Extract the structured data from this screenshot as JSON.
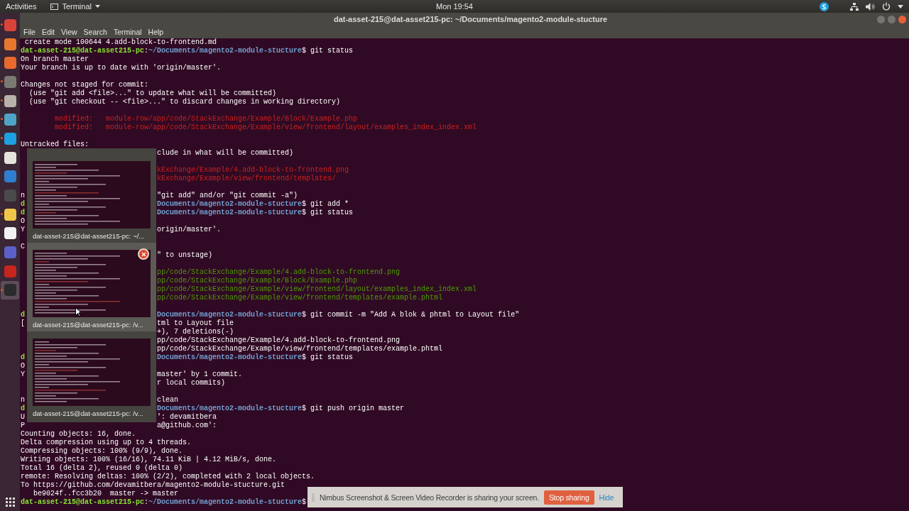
{
  "top_bar": {
    "activities": "Activities",
    "app_menu": "Terminal",
    "clock": "Mon 19:54"
  },
  "dock": {
    "items": [
      {
        "color": "#d9443a",
        "running": true,
        "selected": false
      },
      {
        "color": "#e8772e",
        "running": false,
        "selected": false
      },
      {
        "color": "#e9692c",
        "running": false,
        "selected": false
      },
      {
        "color": "#7a7a72",
        "running": true,
        "selected": false
      },
      {
        "color": "#b8b3aa",
        "running": true,
        "selected": false
      },
      {
        "color": "#4fa3c9",
        "running": true,
        "selected": false
      },
      {
        "color": "#1ea1e0",
        "running": true,
        "selected": false
      },
      {
        "color": "#e6e3dd",
        "running": false,
        "selected": false
      },
      {
        "color": "#2f7ed0",
        "running": false,
        "selected": false
      },
      {
        "color": "#4a4a4a",
        "running": false,
        "selected": false
      },
      {
        "color": "#efc64a",
        "running": true,
        "selected": false
      },
      {
        "color": "#f2f2f2",
        "running": false,
        "selected": false
      },
      {
        "color": "#5b5fc7",
        "running": false,
        "selected": false
      },
      {
        "color": "#c7251e",
        "running": false,
        "selected": false
      },
      {
        "color": "#2b2b2b",
        "running": true,
        "selected": true
      }
    ]
  },
  "window": {
    "title": "dat-asset-215@dat-asset215-pc: ~/Documents/magento2-module-stucture",
    "menu": [
      "File",
      "Edit",
      "View",
      "Search",
      "Terminal",
      "Help"
    ]
  },
  "terminal": {
    "lines": [
      {
        "kind": "full",
        "segments": [
          {
            "kind": "plain",
            "text": " create mode 100644 4.add-block-to-frontend.md"
          }
        ]
      },
      {
        "kind": "full",
        "segments": [
          {
            "kind": "user",
            "text": "dat-asset-215@dat-asset215-pc"
          },
          {
            "kind": "plain",
            "text": ":"
          },
          {
            "kind": "path",
            "text": "~/Documents/magento2-module-stucture"
          },
          {
            "kind": "plain",
            "text": "$ git status"
          }
        ]
      },
      {
        "kind": "full",
        "segments": [
          {
            "kind": "plain",
            "text": "On branch master"
          }
        ]
      },
      {
        "kind": "full",
        "segments": [
          {
            "kind": "plain",
            "text": "Your branch is up to date with 'origin/master'."
          }
        ]
      },
      {
        "kind": "blank"
      },
      {
        "kind": "full",
        "segments": [
          {
            "kind": "plain",
            "text": "Changes not staged for commit:"
          }
        ]
      },
      {
        "kind": "full",
        "segments": [
          {
            "kind": "plain",
            "text": "  (use \"git add <file>...\" to update what will be committed)"
          }
        ]
      },
      {
        "kind": "full",
        "segments": [
          {
            "kind": "plain",
            "text": "  (use \"git checkout -- <file>...\" to discard changes in working directory)"
          }
        ]
      },
      {
        "kind": "blank"
      },
      {
        "kind": "full",
        "segments": [
          {
            "kind": "unstaged",
            "text": "        modified:   module-row/app/code/StackExchange/Example/Block/Example.php"
          }
        ]
      },
      {
        "kind": "full",
        "segments": [
          {
            "kind": "unstaged",
            "text": "        modified:   module-row/app/code/StackExchange/Example/view/frontend/layout/examples_index_index.xml"
          }
        ]
      },
      {
        "kind": "blank"
      },
      {
        "kind": "full",
        "segments": [
          {
            "kind": "plain",
            "text": "Untracked files:"
          }
        ]
      },
      {
        "kind": "split",
        "right": [
          {
            "kind": "plain",
            "text": "clude in what will be committed)"
          }
        ]
      },
      {
        "kind": "blank"
      },
      {
        "kind": "split",
        "right": [
          {
            "kind": "unstaged",
            "text": "kExchange/Example/4.add-block-to-frontend.png"
          }
        ]
      },
      {
        "kind": "split",
        "right": [
          {
            "kind": "unstaged",
            "text": "kExchange/Example/view/frontend/templates/"
          }
        ]
      },
      {
        "kind": "blank"
      },
      {
        "kind": "split",
        "left": [
          {
            "kind": "plain",
            "text": "n"
          }
        ],
        "right": [
          {
            "kind": "plain",
            "text": "\"git add\" and/or \"git commit -a\")"
          }
        ]
      },
      {
        "kind": "split",
        "left": [
          {
            "kind": "user",
            "text": "d"
          }
        ],
        "right": [
          {
            "kind": "path",
            "text": "Documents/magento2-module-stucture"
          },
          {
            "kind": "plain",
            "text": "$ git add *"
          }
        ]
      },
      {
        "kind": "split",
        "left": [
          {
            "kind": "user",
            "text": "d"
          }
        ],
        "right": [
          {
            "kind": "path",
            "text": "Documents/magento2-module-stucture"
          },
          {
            "kind": "plain",
            "text": "$ git status"
          }
        ]
      },
      {
        "kind": "split",
        "left": [
          {
            "kind": "plain",
            "text": "O"
          }
        ]
      },
      {
        "kind": "split",
        "left": [
          {
            "kind": "plain",
            "text": "Y"
          }
        ],
        "right": [
          {
            "kind": "plain",
            "text": "origin/master'."
          }
        ]
      },
      {
        "kind": "blank"
      },
      {
        "kind": "split",
        "left": [
          {
            "kind": "plain",
            "text": "C"
          }
        ]
      },
      {
        "kind": "split",
        "right": [
          {
            "kind": "plain",
            "text": "\" to unstage)"
          }
        ]
      },
      {
        "kind": "blank"
      },
      {
        "kind": "split",
        "right": [
          {
            "kind": "staged",
            "text": "pp/code/StackExchange/Example/4.add-block-to-frontend.png"
          }
        ]
      },
      {
        "kind": "split",
        "right": [
          {
            "kind": "staged",
            "text": "pp/code/StackExchange/Example/Block/Example.php"
          }
        ]
      },
      {
        "kind": "split",
        "right": [
          {
            "kind": "staged",
            "text": "pp/code/StackExchange/Example/view/frontend/layout/examples_index_index.xml"
          }
        ]
      },
      {
        "kind": "split",
        "right": [
          {
            "kind": "staged",
            "text": "pp/code/StackExchange/Example/view/frontend/templates/example.phtml"
          }
        ]
      },
      {
        "kind": "blank"
      },
      {
        "kind": "split",
        "left": [
          {
            "kind": "user",
            "text": "d"
          }
        ],
        "right": [
          {
            "kind": "path",
            "text": "Documents/magento2-module-stucture"
          },
          {
            "kind": "plain",
            "text": "$ git commit -m \"Add A blok & phtml to Layout file\""
          }
        ]
      },
      {
        "kind": "split",
        "left": [
          {
            "kind": "plain",
            "text": "["
          }
        ],
        "right": [
          {
            "kind": "plain",
            "text": "tml to Layout file"
          }
        ]
      },
      {
        "kind": "split",
        "right": [
          {
            "kind": "plain",
            "text": "+), 7 deletions(-)"
          }
        ]
      },
      {
        "kind": "split",
        "right": [
          {
            "kind": "plain",
            "text": "pp/code/StackExchange/Example/4.add-block-to-frontend.png"
          }
        ]
      },
      {
        "kind": "split",
        "right": [
          {
            "kind": "plain",
            "text": "pp/code/StackExchange/Example/view/frontend/templates/example.phtml"
          }
        ]
      },
      {
        "kind": "split",
        "left": [
          {
            "kind": "user",
            "text": "d"
          }
        ],
        "right": [
          {
            "kind": "path",
            "text": "Documents/magento2-module-stucture"
          },
          {
            "kind": "plain",
            "text": "$ git status"
          }
        ]
      },
      {
        "kind": "split",
        "left": [
          {
            "kind": "plain",
            "text": "O"
          }
        ]
      },
      {
        "kind": "split",
        "left": [
          {
            "kind": "plain",
            "text": "Y"
          }
        ],
        "right": [
          {
            "kind": "plain",
            "text": "master' by 1 commit."
          }
        ]
      },
      {
        "kind": "split",
        "right": [
          {
            "kind": "plain",
            "text": "r local commits)"
          }
        ]
      },
      {
        "kind": "blank"
      },
      {
        "kind": "split",
        "left": [
          {
            "kind": "plain",
            "text": "n"
          }
        ],
        "right": [
          {
            "kind": "plain",
            "text": "clean"
          }
        ]
      },
      {
        "kind": "split",
        "left": [
          {
            "kind": "user",
            "text": "d"
          }
        ],
        "right": [
          {
            "kind": "path",
            "text": "Documents/magento2-module-stucture"
          },
          {
            "kind": "plain",
            "text": "$ git push origin master"
          }
        ]
      },
      {
        "kind": "split",
        "left": [
          {
            "kind": "plain",
            "text": "U"
          }
        ],
        "right": [
          {
            "kind": "plain",
            "text": "': devamitbera"
          }
        ]
      },
      {
        "kind": "split",
        "left": [
          {
            "kind": "plain",
            "text": "P"
          }
        ],
        "right": [
          {
            "kind": "plain",
            "text": "a@github.com':"
          }
        ]
      },
      {
        "kind": "full",
        "segments": [
          {
            "kind": "plain",
            "text": "Counting objects: 16, done."
          }
        ]
      },
      {
        "kind": "full",
        "segments": [
          {
            "kind": "plain",
            "text": "Delta compression using up to 4 threads."
          }
        ]
      },
      {
        "kind": "full",
        "segments": [
          {
            "kind": "plain",
            "text": "Compressing objects: 100% (9/9), done."
          }
        ]
      },
      {
        "kind": "full",
        "segments": [
          {
            "kind": "plain",
            "text": "Writing objects: 100% (16/16), 74.11 KiB | 4.12 MiB/s, done."
          }
        ]
      },
      {
        "kind": "full",
        "segments": [
          {
            "kind": "plain",
            "text": "Total 16 (delta 2), reused 0 (delta 0)"
          }
        ]
      },
      {
        "kind": "full",
        "segments": [
          {
            "kind": "plain",
            "text": "remote: Resolving deltas: 100% (2/2), completed with 2 local objects."
          }
        ]
      },
      {
        "kind": "full",
        "segments": [
          {
            "kind": "plain",
            "text": "To https://github.com/devamitbera/magento2-module-stucture.git"
          }
        ]
      },
      {
        "kind": "full",
        "segments": [
          {
            "kind": "plain",
            "text": "   be9024f..fcc3b20  master -> master"
          }
        ]
      },
      {
        "kind": "full",
        "segments": [
          {
            "kind": "user",
            "text": "dat-asset-215@dat-asset215-pc"
          },
          {
            "kind": "plain",
            "text": ":"
          },
          {
            "kind": "path",
            "text": "~/Documents/magento2-module-stucture"
          },
          {
            "kind": "plain",
            "text": "$"
          }
        ]
      }
    ]
  },
  "switcher": {
    "windows": [
      {
        "label": "dat-asset-215@dat-asset215-pc: ~/...",
        "selected": false
      },
      {
        "label": "dat-asset-215@dat-asset215-pc: /v...",
        "selected": true
      },
      {
        "label": "dat-asset-215@dat-asset215-pc: /v...",
        "selected": false
      }
    ]
  },
  "share_banner": {
    "message": "Nimbus Screenshot & Screen Video Recorder is sharing your screen.",
    "stop": "Stop sharing",
    "hide": "Hide"
  }
}
